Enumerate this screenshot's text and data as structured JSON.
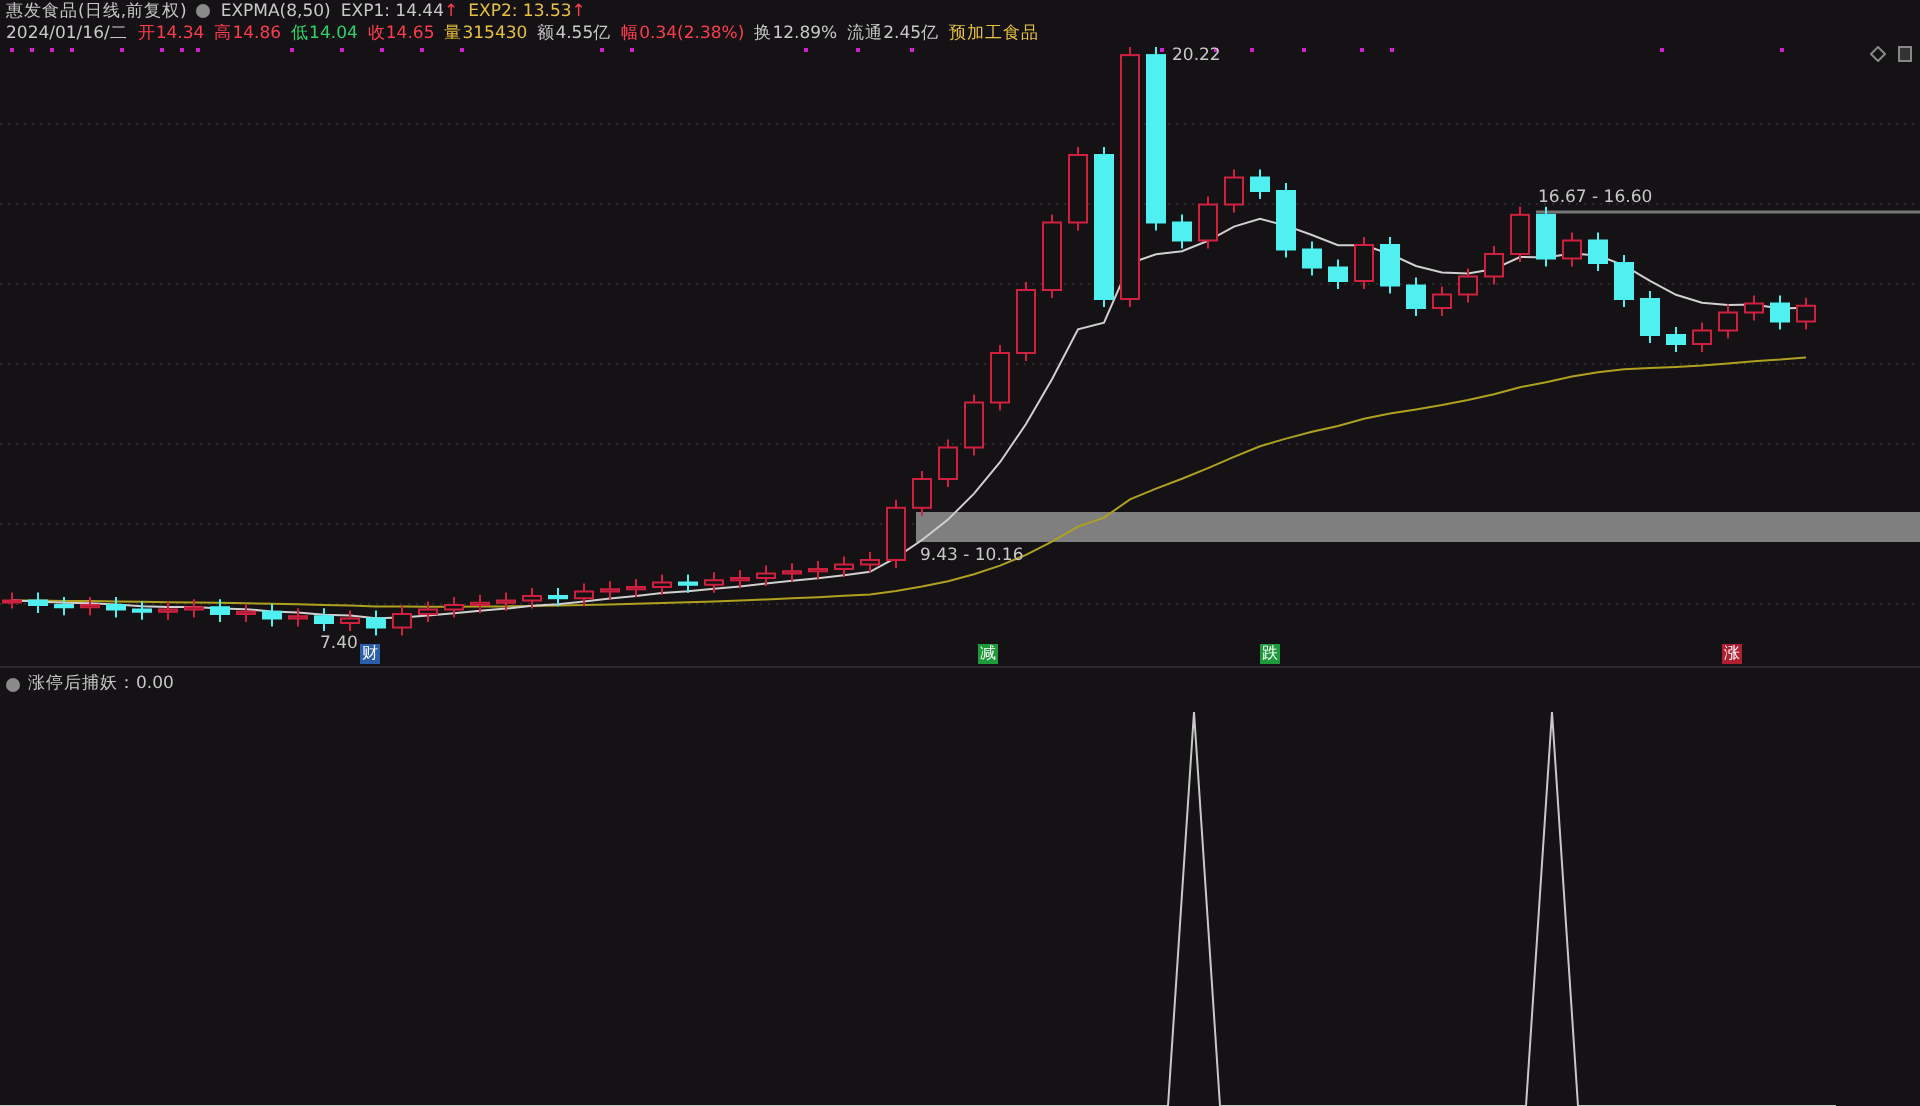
{
  "header": {
    "title": "惠发食品(日线,前复权)",
    "indicator": "EXPMA(8,50)",
    "exp1": {
      "label": "EXP1: 14.44",
      "arrow": "↑"
    },
    "exp2": {
      "label": "EXP2: 13.53",
      "arrow": "↑"
    }
  },
  "quote": [
    {
      "text": "2024/01/16/二",
      "color": "#c8c8c8"
    },
    {
      "text": "开14.34",
      "color": "#ff3b4f"
    },
    {
      "text": "高14.86",
      "color": "#ff3b4f"
    },
    {
      "text": "低14.04",
      "color": "#2bd46a"
    },
    {
      "text": "收14.65",
      "color": "#ff3b4f"
    },
    {
      "text": "量315430",
      "color": "#e8c040"
    },
    {
      "text": "额4.55亿",
      "color": "#c8c8c8"
    },
    {
      "text": "幅0.34(2.38%)",
      "color": "#ff3b4f"
    },
    {
      "text": "换12.89%",
      "color": "#c8c8c8"
    },
    {
      "text": "流通2.45亿",
      "color": "#c8c8c8"
    },
    {
      "text": "预加工食品",
      "color": "#e8c040"
    }
  ],
  "price_labels": {
    "high": "20.22",
    "upper_zone": "16.67 - 16.60",
    "lower_zone": "9.43 - 10.16",
    "low": "7.40"
  },
  "markers": [
    {
      "text": "财",
      "color": "#2a5ea8"
    },
    {
      "text": "减",
      "color": "#1e9a3a"
    },
    {
      "text": "跌",
      "color": "#1e9a3a"
    },
    {
      "text": "涨",
      "color": "#b02030"
    }
  ],
  "lower_panel": {
    "label": "涨停后捕妖：0.00"
  }
}
